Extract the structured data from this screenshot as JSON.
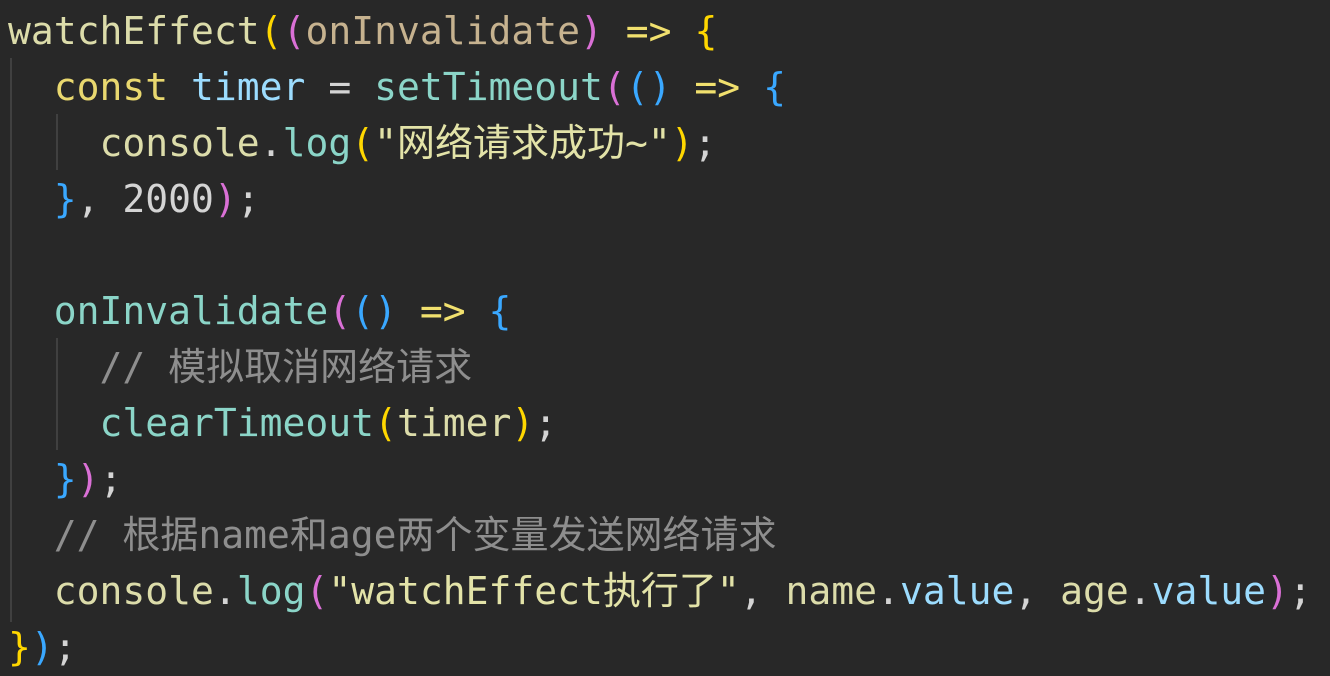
{
  "code": {
    "lines": [
      [
        {
          "t": "watchEffect",
          "c": "fn"
        },
        {
          "t": "(",
          "c": "b1"
        },
        {
          "t": "(",
          "c": "b2"
        },
        {
          "t": "onInvalidate",
          "c": "param"
        },
        {
          "t": ")",
          "c": "b2"
        },
        {
          "t": " ",
          "c": "punc"
        },
        {
          "t": "=>",
          "c": "arrow"
        },
        {
          "t": " ",
          "c": "punc"
        },
        {
          "t": "{",
          "c": "b1"
        }
      ],
      [
        {
          "t": "  ",
          "c": "punc"
        },
        {
          "t": "const",
          "c": "kw"
        },
        {
          "t": " ",
          "c": "punc"
        },
        {
          "t": "timer",
          "c": "var"
        },
        {
          "t": " = ",
          "c": "punc"
        },
        {
          "t": "setTimeout",
          "c": "fn2"
        },
        {
          "t": "(",
          "c": "b2"
        },
        {
          "t": "()",
          "c": "b3"
        },
        {
          "t": " ",
          "c": "punc"
        },
        {
          "t": "=>",
          "c": "arrow"
        },
        {
          "t": " ",
          "c": "punc"
        },
        {
          "t": "{",
          "c": "b3"
        }
      ],
      [
        {
          "t": "    ",
          "c": "punc"
        },
        {
          "t": "console",
          "c": "fnlog"
        },
        {
          "t": ".",
          "c": "punc"
        },
        {
          "t": "log",
          "c": "fn2"
        },
        {
          "t": "(",
          "c": "b1"
        },
        {
          "t": "\"网络请求成功~\"",
          "c": "str"
        },
        {
          "t": ")",
          "c": "b1"
        },
        {
          "t": ";",
          "c": "punc"
        }
      ],
      [
        {
          "t": "  ",
          "c": "punc"
        },
        {
          "t": "}",
          "c": "b3"
        },
        {
          "t": ", ",
          "c": "punc"
        },
        {
          "t": "2000",
          "c": "num"
        },
        {
          "t": ")",
          "c": "b2"
        },
        {
          "t": ";",
          "c": "punc"
        }
      ],
      [],
      [
        {
          "t": "  ",
          "c": "punc"
        },
        {
          "t": "onInvalidate",
          "c": "fn2"
        },
        {
          "t": "(",
          "c": "b2"
        },
        {
          "t": "()",
          "c": "b3"
        },
        {
          "t": " ",
          "c": "punc"
        },
        {
          "t": "=>",
          "c": "arrow"
        },
        {
          "t": " ",
          "c": "punc"
        },
        {
          "t": "{",
          "c": "b3"
        }
      ],
      [
        {
          "t": "    ",
          "c": "punc"
        },
        {
          "t": "// 模拟取消网络请求",
          "c": "com"
        }
      ],
      [
        {
          "t": "    ",
          "c": "punc"
        },
        {
          "t": "clearTimeout",
          "c": "fn2"
        },
        {
          "t": "(",
          "c": "b1"
        },
        {
          "t": "timer",
          "c": "fnlog"
        },
        {
          "t": ")",
          "c": "b1"
        },
        {
          "t": ";",
          "c": "punc"
        }
      ],
      [
        {
          "t": "  ",
          "c": "punc"
        },
        {
          "t": "}",
          "c": "b3"
        },
        {
          "t": ")",
          "c": "b2"
        },
        {
          "t": ";",
          "c": "punc"
        }
      ],
      [
        {
          "t": "  ",
          "c": "punc"
        },
        {
          "t": "// 根据name和age两个变量发送网络请求",
          "c": "com"
        }
      ],
      [
        {
          "t": "  ",
          "c": "punc"
        },
        {
          "t": "console",
          "c": "fnlog"
        },
        {
          "t": ".",
          "c": "punc"
        },
        {
          "t": "log",
          "c": "fn2"
        },
        {
          "t": "(",
          "c": "b2"
        },
        {
          "t": "\"watchEffect执行了\"",
          "c": "str"
        },
        {
          "t": ", ",
          "c": "punc"
        },
        {
          "t": "name",
          "c": "fnlog"
        },
        {
          "t": ".",
          "c": "punc"
        },
        {
          "t": "value",
          "c": "var"
        },
        {
          "t": ", ",
          "c": "punc"
        },
        {
          "t": "age",
          "c": "fnlog"
        },
        {
          "t": ".",
          "c": "punc"
        },
        {
          "t": "value",
          "c": "var"
        },
        {
          "t": ")",
          "c": "b2"
        },
        {
          "t": ";",
          "c": "punc"
        }
      ],
      [
        {
          "t": "}",
          "c": "b1"
        },
        {
          "t": ")",
          "c": "b3"
        },
        {
          "t": ";",
          "c": "punc"
        }
      ]
    ]
  }
}
